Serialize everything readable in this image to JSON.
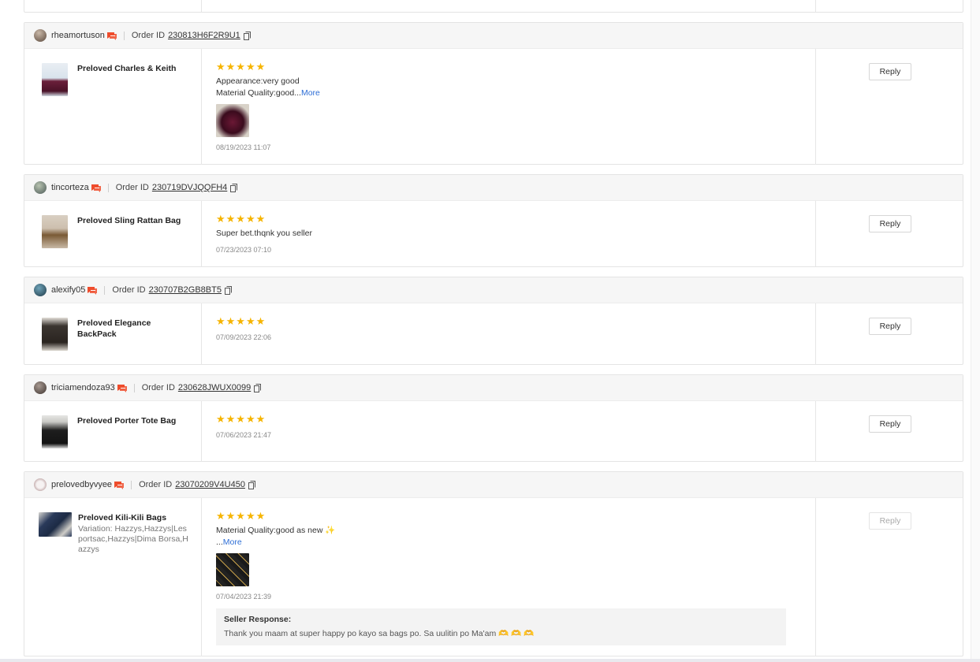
{
  "reviews": [
    {
      "username": "rheamortuson",
      "order_label": "Order ID",
      "order_id": "230813H6F2R9U1",
      "product_name": "Preloved Charles & Keith",
      "variation": "",
      "stars": "★★★★★",
      "review_lines": [
        "Appearance:very good",
        "Material Quality:good..."
      ],
      "more": "More",
      "date": "08/19/2023 11:07",
      "reply": "Reply"
    },
    {
      "username": "tincorteza",
      "order_label": "Order ID",
      "order_id": "230719DVJQQFH4",
      "product_name": "Preloved Sling Rattan Bag",
      "variation": "",
      "stars": "★★★★★",
      "review_lines": [
        "Super bet.thqnk you seller"
      ],
      "date": "07/23/2023 07:10",
      "reply": "Reply"
    },
    {
      "username": "alexify05",
      "order_label": "Order ID",
      "order_id": "230707B2GB8BT5",
      "product_name": "Preloved Elegance BackPack",
      "variation": "",
      "stars": "★★★★★",
      "review_lines": [],
      "date": "07/09/2023 22:06",
      "reply": "Reply"
    },
    {
      "username": "triciamendoza93",
      "order_label": "Order ID",
      "order_id": "230628JWUX0099",
      "product_name": "Preloved Porter Tote Bag",
      "variation": "",
      "stars": "★★★★★",
      "review_lines": [],
      "date": "07/06/2023 21:47",
      "reply": "Reply"
    },
    {
      "username": "prelovedbyvyee",
      "order_label": "Order ID",
      "order_id": "23070209V4U450",
      "product_name": "Preloved Kili-Kili Bags",
      "variation": "Variation: Hazzys,Hazzys|Lesportsac,Hazzys|Dima Borsa,Hazzys",
      "stars": "★★★★★",
      "review_lines": [
        "Material Quality:good as new ✨"
      ],
      "more": "More",
      "date": "07/04/2023 21:39",
      "reply": "Reply",
      "seller_response_title": "Seller Response:",
      "seller_response_text": "Thank you maam at super happy po kayo sa bags po. Sa uulitin po Ma'am",
      "seller_response_emoji": "🫶 🫶 🫶"
    }
  ],
  "colors": {
    "star": "#f6b400",
    "link": "#2f6fd6",
    "chat_icon": "#ee4d2d"
  },
  "icons": {
    "chat": "chat-icon",
    "copy": "copy-icon"
  }
}
